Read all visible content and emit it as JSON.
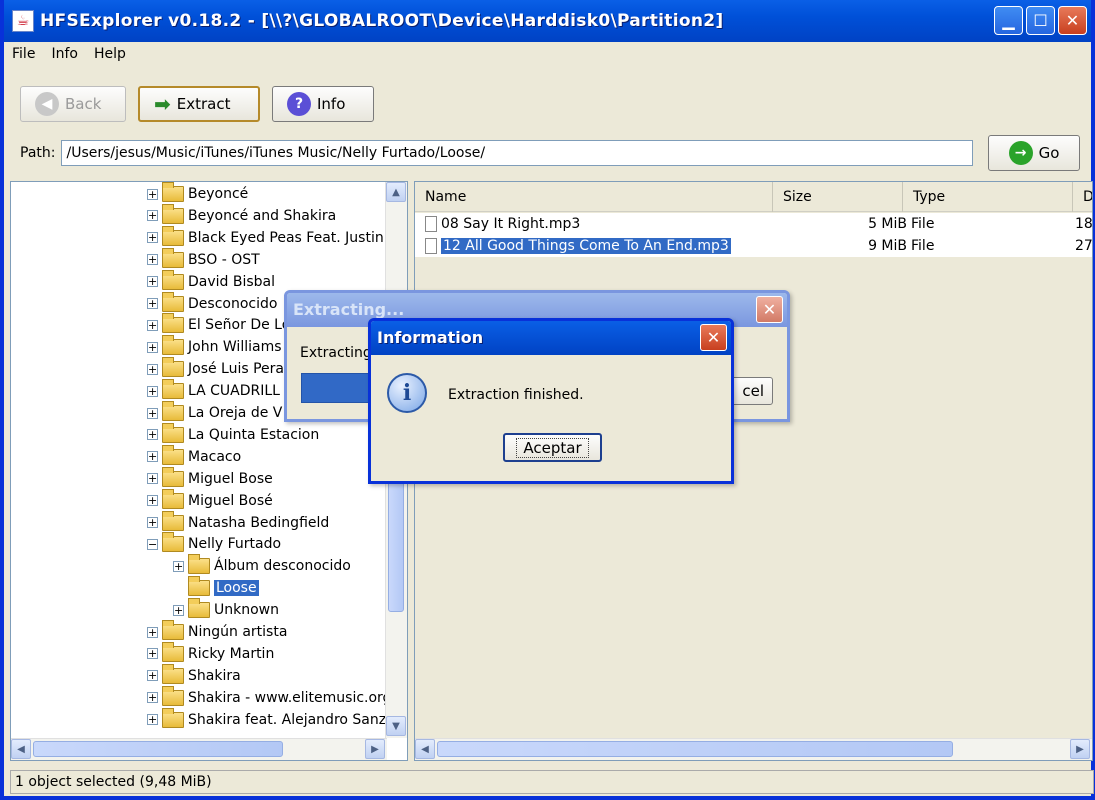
{
  "window": {
    "title": "HFSExplorer v0.18.2 - [\\\\?\\GLOBALROOT\\Device\\Harddisk0\\Partition2]",
    "app_icon": "java-cup-icon"
  },
  "menu": [
    "File",
    "Info",
    "Help"
  ],
  "toolbar": {
    "back_label": "Back",
    "extract_label": "Extract",
    "info_label": "Info"
  },
  "path": {
    "label": "Path:",
    "value": "/Users/jesus/Music/iTunes/iTunes Music/Nelly Furtado/Loose/",
    "go_label": "Go"
  },
  "tree": [
    {
      "label": "Beyoncé",
      "level": 0,
      "expander": "+"
    },
    {
      "label": "Beyoncé and Shakira",
      "level": 0,
      "expander": "+"
    },
    {
      "label": "Black Eyed Peas Feat. Justin",
      "level": 0,
      "expander": "+"
    },
    {
      "label": "BSO - OST",
      "level": 0,
      "expander": "+"
    },
    {
      "label": "David Bisbal",
      "level": 0,
      "expander": "+"
    },
    {
      "label": "Desconocido",
      "level": 0,
      "expander": "+"
    },
    {
      "label": "El Señor De Lo",
      "level": 0,
      "expander": "+"
    },
    {
      "label": "John Williams",
      "level": 0,
      "expander": "+"
    },
    {
      "label": "José Luis Pera",
      "level": 0,
      "expander": "+"
    },
    {
      "label": "LA CUADRILL",
      "level": 0,
      "expander": "+"
    },
    {
      "label": "La Oreja de V",
      "level": 0,
      "expander": "+"
    },
    {
      "label": "La Quinta Estacion",
      "level": 0,
      "expander": "+"
    },
    {
      "label": "Macaco",
      "level": 0,
      "expander": "+"
    },
    {
      "label": "Miguel Bose",
      "level": 0,
      "expander": "+"
    },
    {
      "label": "Miguel Bosé",
      "level": 0,
      "expander": "+"
    },
    {
      "label": "Natasha Bedingfield",
      "level": 0,
      "expander": "+"
    },
    {
      "label": "Nelly Furtado",
      "level": 0,
      "expander": "−"
    },
    {
      "label": "Álbum desconocido",
      "level": 1,
      "expander": "+"
    },
    {
      "label": "Loose",
      "level": 1,
      "expander": "",
      "selected": true
    },
    {
      "label": "Unknown",
      "level": 1,
      "expander": "+"
    },
    {
      "label": "Ningún artista",
      "level": 0,
      "expander": "+"
    },
    {
      "label": "Ricky Martin",
      "level": 0,
      "expander": "+"
    },
    {
      "label": "Shakira",
      "level": 0,
      "expander": "+"
    },
    {
      "label": "Shakira - www.elitemusic.org",
      "level": 0,
      "expander": "+"
    },
    {
      "label": "Shakira feat. Alejandro Sanz",
      "level": 0,
      "expander": "+"
    }
  ],
  "table": {
    "columns": [
      "Name",
      "Size",
      "Type",
      "D"
    ],
    "rows": [
      {
        "name": "08 Say It Right.mp3",
        "size": "5 MiB",
        "type": "File",
        "date": "18"
      },
      {
        "name": "12 All Good Things Come To An End.mp3",
        "size": "9 MiB",
        "type": "File",
        "date": "27",
        "selected": true
      }
    ]
  },
  "status": "1 object selected (9,48 MiB)",
  "extract_dialog": {
    "title": "Extracting...",
    "label": "Extracting",
    "cancel_label": "cel"
  },
  "info_dialog": {
    "title": "Information",
    "message": "Extraction finished.",
    "ok_label": "Aceptar"
  },
  "colors": {
    "titlebar": "#0050d8",
    "selection": "#316ac5",
    "face": "#ece9d8"
  }
}
